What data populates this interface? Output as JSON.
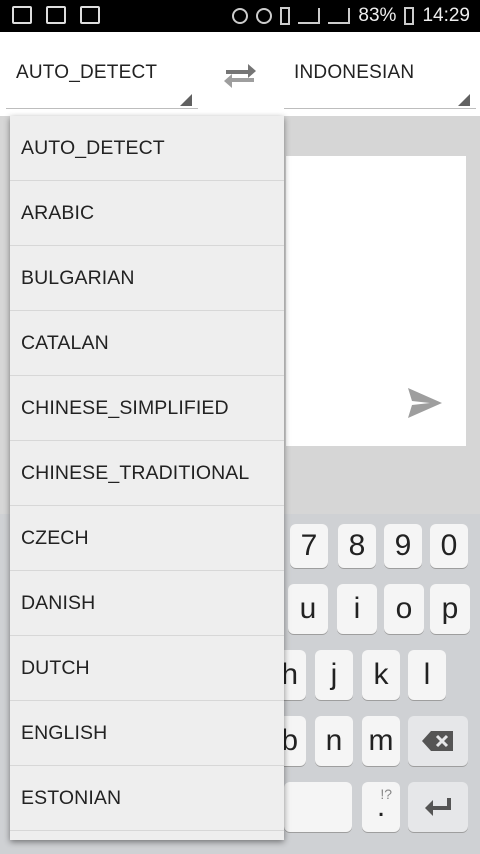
{
  "status": {
    "battery": "83%",
    "time": "14:29"
  },
  "source_lang": "AUTO_DETECT",
  "target_lang": "INDONESIAN",
  "dropdown": {
    "items": [
      "AUTO_DETECT",
      "ARABIC",
      "BULGARIAN",
      "CATALAN",
      "CHINESE_SIMPLIFIED",
      "CHINESE_TRADITIONAL",
      "CZECH",
      "DANISH",
      "DUTCH",
      "ENGLISH",
      "ESTONIAN"
    ]
  },
  "keyboard": {
    "row1": [
      "7",
      "8",
      "9",
      "0"
    ],
    "row2": [
      "u",
      "i",
      "o",
      "p"
    ],
    "row3": [
      "h",
      "j",
      "k",
      "l"
    ],
    "row4": [
      "b",
      "n",
      "m"
    ],
    "period_key": ".",
    "period_hint": "!?"
  }
}
